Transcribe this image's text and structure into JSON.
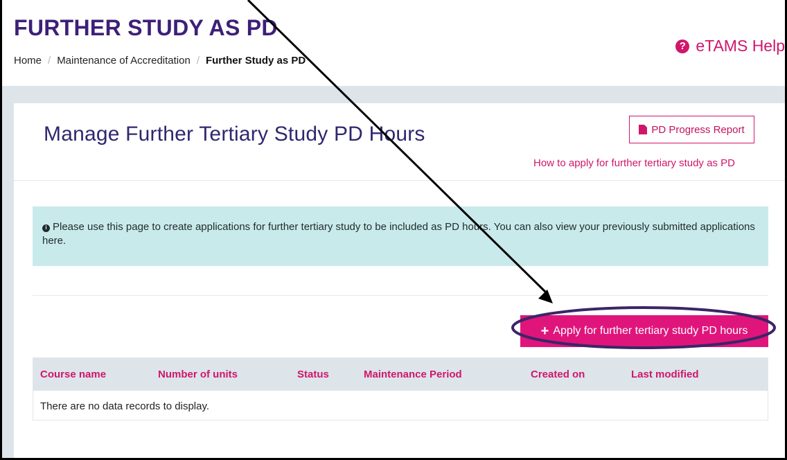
{
  "page": {
    "title": "FURTHER STUDY AS PD",
    "breadcrumb": [
      "Home",
      "Maintenance of Accreditation",
      "Further Study as PD"
    ],
    "help_link": "eTAMS Help"
  },
  "card": {
    "title": "Manage Further Tertiary Study PD Hours",
    "report_button": "PD Progress Report",
    "how_to_link": "How to apply for further tertiary study as PD"
  },
  "info": {
    "text": "Please use this page to create applications for further tertiary study to be included as PD hours. You can also view your previously submitted applications here."
  },
  "actions": {
    "apply_button": "Apply for further tertiary study PD hours"
  },
  "table": {
    "columns": [
      "Course name",
      "Number of units",
      "Status",
      "Maintenance Period",
      "Created on",
      "Last modified"
    ],
    "empty_message": "There are no data records to display."
  },
  "icons": {
    "help": "question-circle-icon",
    "report": "pdf-file-icon",
    "info": "info-circle-icon",
    "add": "plus-icon"
  },
  "colors": {
    "brand_purple": "#3d1f78",
    "accent_pink": "#d0166b",
    "button_pink": "#e0157c",
    "info_bg": "#c9eaea",
    "annotation_ellipse": "#3c2567"
  }
}
